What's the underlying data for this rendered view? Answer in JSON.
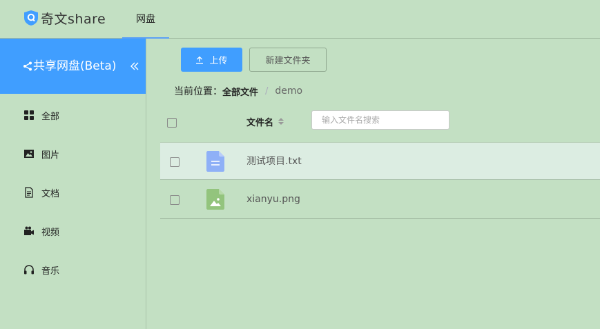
{
  "header": {
    "logo_text": "奇文share",
    "nav_tab": "网盘"
  },
  "sidebar": {
    "title": "共享网盘(Beta)",
    "items": [
      {
        "label": "全部",
        "icon": "grid-icon"
      },
      {
        "label": "图片",
        "icon": "image-icon"
      },
      {
        "label": "文档",
        "icon": "document-icon"
      },
      {
        "label": "视频",
        "icon": "video-camera-icon"
      },
      {
        "label": "音乐",
        "icon": "headphones-icon"
      }
    ]
  },
  "toolbar": {
    "upload_label": "上传",
    "new_folder_label": "新建文件夹"
  },
  "breadcrumb": {
    "prefix": "当前位置：",
    "root": "全部文件",
    "separator": "/",
    "current": "demo"
  },
  "table": {
    "column_name": "文件名",
    "search_placeholder": "输入文件名搜索",
    "rows": [
      {
        "name": "测试项目.txt",
        "type": "document"
      },
      {
        "name": "xianyu.png",
        "type": "image"
      }
    ]
  },
  "colors": {
    "accent": "#409eff",
    "background": "#c3e0c3",
    "doc_icon": "#8fb0f7",
    "image_icon": "#93c47d"
  }
}
